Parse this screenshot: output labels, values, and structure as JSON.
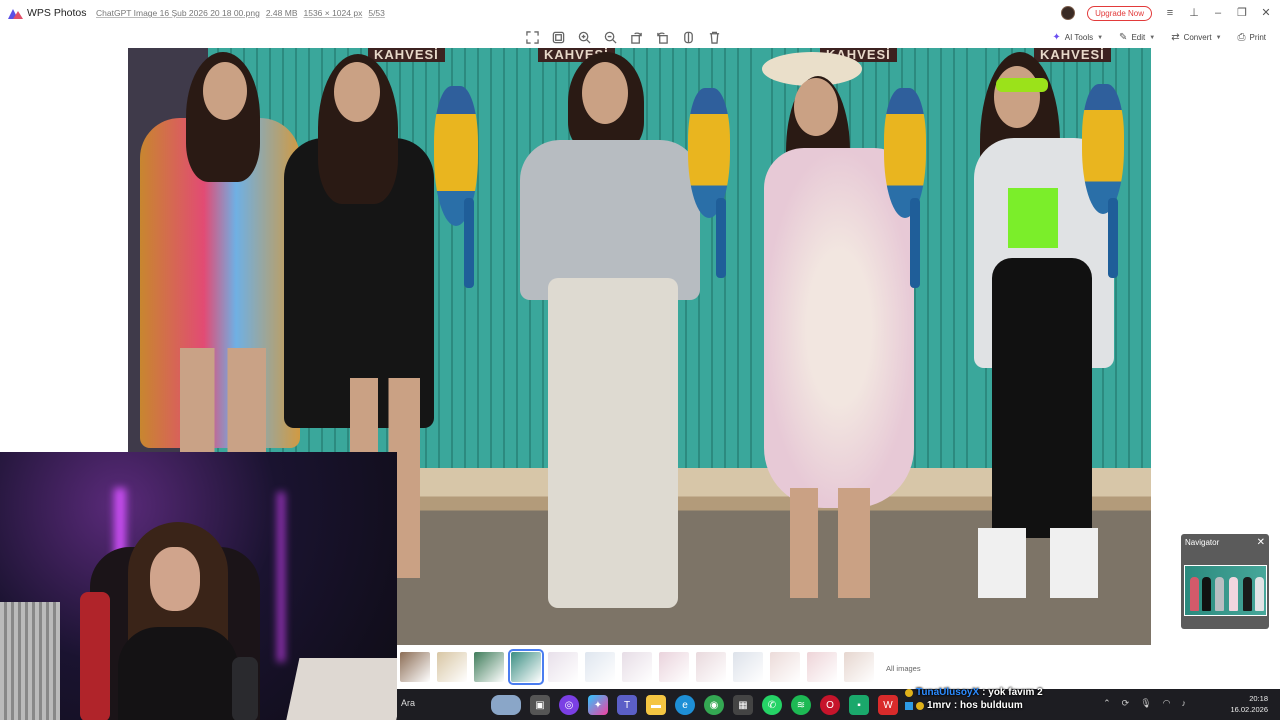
{
  "app": {
    "name": "WPS Photos",
    "file_name": "ChatGPT Image 16 Şub 2026 20 18 00.png",
    "file_size": "2.48 MB",
    "dimensions": "1536 × 1024 px",
    "index": "5/53",
    "upgrade_label": "Upgrade Now"
  },
  "toolbar": {
    "center_tools": [
      "fullscreen-icon",
      "fit-icon",
      "zoom-in-icon",
      "zoom-out-icon",
      "rotate-left-icon",
      "rotate-right-icon",
      "flip-icon",
      "delete-icon"
    ],
    "ai_tools_label": "AI Tools",
    "edit_label": "Edit",
    "convert_label": "Convert",
    "print_label": "Print"
  },
  "photo": {
    "sign_text": "KAHVESİ"
  },
  "filmstrip": {
    "thumbnail_count": 13,
    "active_index": 3,
    "all_images_label": "All images"
  },
  "navigator": {
    "title": "Navigator"
  },
  "chat": {
    "messages": [
      {
        "user": "TunaUlusoyX",
        "text": ": yok favım 2"
      },
      {
        "user": "1mrv",
        "text": ": hos bulduum"
      }
    ]
  },
  "taskbar": {
    "search_label": "Ara",
    "time": "20:18",
    "date": "16.02.2026"
  },
  "colors": {
    "accent": "#4a7df0",
    "upgrade": "#e23a3a",
    "ai": "#6a4ef0",
    "wall": "#3aa79b"
  }
}
